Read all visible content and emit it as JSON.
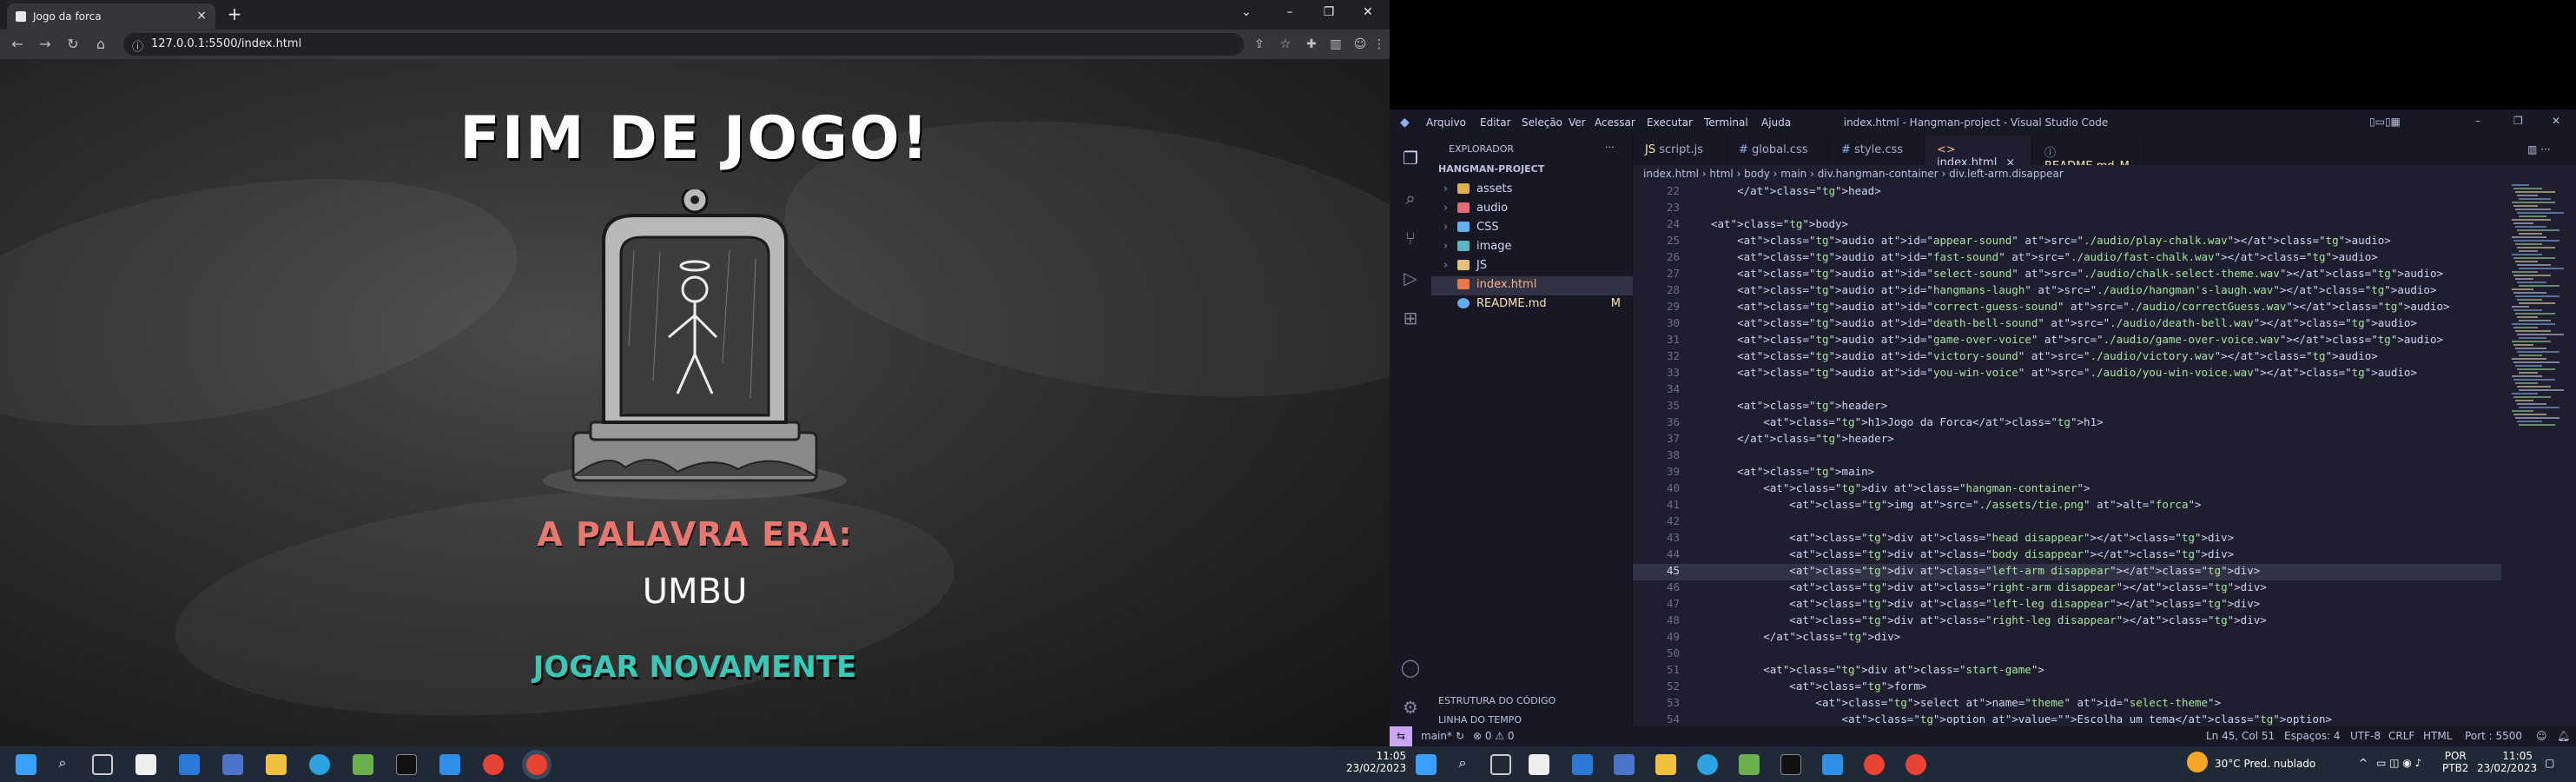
{
  "browser": {
    "tab_title": "Jogo da forca",
    "url": "127.0.0.1:5500/index.html"
  },
  "game": {
    "title": "FIM DE JOGO!",
    "word_label": "A PALAVRA ERA:",
    "word": "UMBU",
    "play_again": "JOGAR NOVAMENTE",
    "colors": {
      "label": "#e8776f",
      "button": "#37c9b6"
    }
  },
  "vscode": {
    "menu": [
      "Arquivo",
      "Editar",
      "Seleção",
      "Ver",
      "Acessar",
      "Executar",
      "Terminal",
      "Ajuda"
    ],
    "window_title": "index.html - Hangman-project - Visual Studio Code",
    "explorer_title": "EXPLORADOR",
    "project": "HANGMAN-PROJECT",
    "tree": [
      {
        "label": "assets",
        "icon": "folder-icon"
      },
      {
        "label": "audio",
        "icon": "folder-icon"
      },
      {
        "label": "CSS",
        "icon": "folder-icon"
      },
      {
        "label": "image",
        "icon": "folder-icon"
      },
      {
        "label": "JS",
        "icon": "folder-icon"
      },
      {
        "label": "index.html",
        "icon": "html-file-icon"
      },
      {
        "label": "README.md",
        "icon": "info-file-icon",
        "badge": "M"
      }
    ],
    "outline": "ESTRUTURA DO CÓDIGO",
    "timeline": "LINHA DO TEMPO",
    "tabs": [
      {
        "label": "script.js"
      },
      {
        "label": "global.css"
      },
      {
        "label": "style.css"
      },
      {
        "label": "index.html",
        "close": "×"
      },
      {
        "label": "README.md",
        "badge": "M"
      }
    ],
    "breadcrumb": "index.html  ›  html  ›  body  ›  main  ›  div.hangman-container  ›  div.left-arm.disappear",
    "lines": [
      {
        "n": "22",
        "code": "    </head>"
      },
      {
        "n": "23",
        "code": ""
      },
      {
        "n": "24",
        "code": "<body>"
      },
      {
        "n": "25",
        "code": "    <audio id=\"appear-sound\" src=\"./audio/play-chalk.wav\"></audio>"
      },
      {
        "n": "26",
        "code": "    <audio id=\"fast-sound\" src=\"./audio/fast-chalk.wav\"></audio>"
      },
      {
        "n": "27",
        "code": "    <audio id=\"select-sound\" src=\"./audio/chalk-select-theme.wav\"></audio>"
      },
      {
        "n": "28",
        "code": "    <audio id=\"hangmans-laugh\" src=\"./audio/hangman's-laugh.wav\"></audio>"
      },
      {
        "n": "29",
        "code": "    <audio id=\"correct-guess-sound\" src=\"./audio/correctGuess.wav\"></audio>"
      },
      {
        "n": "30",
        "code": "    <audio id=\"death-bell-sound\" src=\"./audio/death-bell.wav\"></audio>"
      },
      {
        "n": "31",
        "code": "    <audio id=\"game-over-voice\" src=\"./audio/game-over-voice.wav\"></audio>"
      },
      {
        "n": "32",
        "code": "    <audio id=\"victory-sound\" src=\"./audio/victory.wav\"></audio>"
      },
      {
        "n": "33",
        "code": "    <audio id=\"you-win-voice\" src=\"./audio/you-win-voice.wav\"></audio>"
      },
      {
        "n": "34",
        "code": ""
      },
      {
        "n": "35",
        "code": "    <header>"
      },
      {
        "n": "36",
        "code": "        <h1>Jogo da Forca</h1>"
      },
      {
        "n": "37",
        "code": "    </header>"
      },
      {
        "n": "38",
        "code": ""
      },
      {
        "n": "39",
        "code": "    <main>"
      },
      {
        "n": "40",
        "code": "        <div class=\"hangman-container\">"
      },
      {
        "n": "41",
        "code": "            <img src=\"./assets/tie.png\" alt=\"forca\">"
      },
      {
        "n": "42",
        "code": ""
      },
      {
        "n": "43",
        "code": "            <div class=\"head disappear\"></div>"
      },
      {
        "n": "44",
        "code": "            <div class=\"body disappear\"></div>"
      },
      {
        "n": "45",
        "code": "            <div class=\"left-arm disappear\"></div>"
      },
      {
        "n": "46",
        "code": "            <div class=\"right-arm disappear\"></div>"
      },
      {
        "n": "47",
        "code": "            <div class=\"left-leg disappear\"></div>"
      },
      {
        "n": "48",
        "code": "            <div class=\"right-leg disappear\"></div>"
      },
      {
        "n": "49",
        "code": "        </div>"
      },
      {
        "n": "50",
        "code": ""
      },
      {
        "n": "51",
        "code": "        <div class=\"start-game\">"
      },
      {
        "n": "52",
        "code": "            <form>"
      },
      {
        "n": "53",
        "code": "                <select name=\"theme\" id=\"select-theme\">"
      },
      {
        "n": "54",
        "code": "                    <option value=\"\">Escolha um tema</option>"
      }
    ],
    "status": {
      "branch": "main*",
      "problems": "⊗ 0 ⚠ 0",
      "position": "Ln 45, Col 51",
      "spaces": "Espaços: 4",
      "encoding": "UTF-8",
      "eol": "CRLF",
      "lang": "HTML",
      "port": "Port : 5500"
    }
  },
  "taskbar": {
    "left_time": "11:05",
    "left_date": "23/02/2023",
    "weather": "30°C  Pred. nublado",
    "lang": "POR",
    "lang2": "PTB2",
    "right_time": "11:05",
    "right_date": "23/02/2023"
  }
}
